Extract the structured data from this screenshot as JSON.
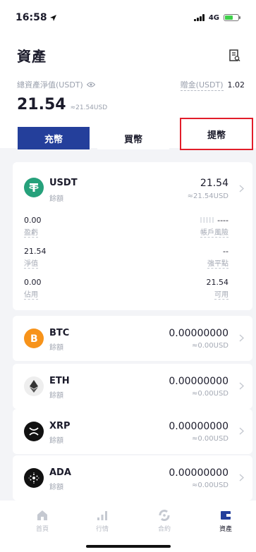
{
  "status": {
    "time": "16:58",
    "network": "4G"
  },
  "header": {
    "title": "資產",
    "net_label": "總資產淨值(USDT)",
    "net_value": "21.54",
    "net_usd": "≈21.54USD",
    "bonus_label": "贈金(USDT)",
    "bonus_value": "1.02"
  },
  "actions": {
    "deposit": "充幣",
    "buy": "買幣",
    "withdraw": "提幣"
  },
  "usdt": {
    "name": "USDT",
    "sub": "餘額",
    "amount": "21.54",
    "usd": "≈21.54USD",
    "stats": [
      {
        "value": "0.00",
        "label": "盈虧"
      },
      {
        "value": "----",
        "label": "帳戶風險",
        "bar": "IIIII"
      },
      {
        "value": "21.54",
        "label": "淨值"
      },
      {
        "value": "--",
        "label": "強平點"
      },
      {
        "value": "0.00",
        "label": "佔用"
      },
      {
        "value": "21.54",
        "label": "可用"
      }
    ]
  },
  "coins": [
    {
      "name": "BTC",
      "sub": "餘額",
      "amount": "0.00000000",
      "usd": "≈0.00USD"
    },
    {
      "name": "ETH",
      "sub": "餘額",
      "amount": "0.00000000",
      "usd": "≈0.00USD"
    },
    {
      "name": "XRP",
      "sub": "餘額",
      "amount": "0.00000000",
      "usd": "≈0.00USD"
    },
    {
      "name": "ADA",
      "sub": "餘額",
      "amount": "0.00000000",
      "usd": "≈0.00USD"
    }
  ],
  "colors": {
    "accent": "#243f9b",
    "highlight": "#e21d2a",
    "btc": "#f7931a",
    "usdt": "#26a17b"
  },
  "tabs": [
    {
      "label": "首頁",
      "icon": "home-icon"
    },
    {
      "label": "行情",
      "icon": "market-icon"
    },
    {
      "label": "合約",
      "icon": "contract-icon"
    },
    {
      "label": "資產",
      "icon": "assets-icon"
    }
  ]
}
